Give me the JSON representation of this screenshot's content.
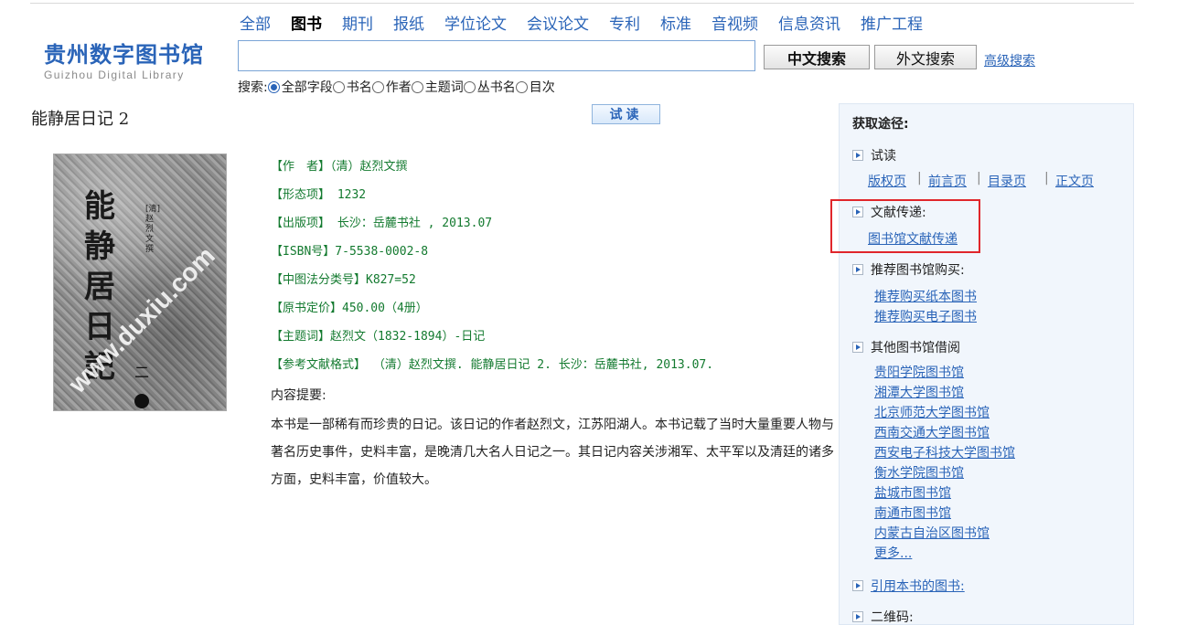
{
  "logo": {
    "cn": "贵州数字图书馆",
    "en": "Guizhou Digital Library"
  },
  "nav": [
    "全部",
    "图书",
    "期刊",
    "报纸",
    "学位论文",
    "会议论文",
    "专利",
    "标准",
    "音视频",
    "信息资讯",
    "推广工程"
  ],
  "nav_active": "图书",
  "search": {
    "value": "",
    "btn_cn": "中文搜索",
    "btn_wai": "外文搜索",
    "advanced": "高级搜索",
    "field_prefix": "搜索:",
    "fields": [
      "全部字段",
      "书名",
      "作者",
      "主题词",
      "丛书名",
      "目次"
    ],
    "selected_field": "全部字段"
  },
  "book": {
    "title": "能静居日记 2",
    "try_read": "试读",
    "cover": {
      "title_chars": "能静居日記",
      "side_text": "[清]赵烈文撰",
      "volume": "二",
      "watermark": "www.duxiu.com"
    },
    "meta": [
      "【作　者】（清）赵烈文撰",
      "【形态项】 1232",
      "【出版项】 长沙：岳麓书社 , 2013.07",
      "【ISBN号】7-5538-0002-8",
      "【中图法分类号】K827=52",
      "【原书定价】450.00（4册）",
      "【主题词】赵烈文（1832-1894）-日记",
      "【参考文献格式】 （清）赵烈文撰. 能静居日记 2. 长沙：岳麓书社, 2013.07."
    ],
    "summary_label": "内容提要:",
    "summary": "本书是一部稀有而珍贵的日记。该日记的作者赵烈文，江苏阳湖人。本书记载了当时大量重要人物与著名历史事件，史料丰富，是晚清几大名人日记之一。其日记内容关涉湘军、太平军以及清廷的诸多方面，史料丰富，价值较大。"
  },
  "panel": {
    "title": "获取途径:",
    "trial": {
      "label": "试读",
      "links": [
        "版权页",
        "前言页",
        "目录页",
        "正文页"
      ]
    },
    "delivery": {
      "label": "文献传递:",
      "link": "图书馆文献传递"
    },
    "recommend": {
      "label": "推荐图书馆购买:",
      "links": [
        "推荐购买纸本图书",
        "推荐购买电子图书"
      ]
    },
    "other": {
      "label": "其他图书馆借阅",
      "links": [
        "贵阳学院图书馆",
        "湘潭大学图书馆",
        "北京师范大学图书馆",
        "西南交通大学图书馆",
        "西安电子科技大学图书馆",
        "衡水学院图书馆",
        "盐城市图书馆",
        "南通市图书馆",
        "内蒙古自治区图书馆",
        "更多..."
      ]
    },
    "cited": "引用本书的图书:",
    "qrcode": "二维码:"
  },
  "colors": {
    "link": "#2a64b8",
    "meta": "#137a2f",
    "highlight": "#e0262b",
    "panel_bg": "#f1f6fc"
  }
}
